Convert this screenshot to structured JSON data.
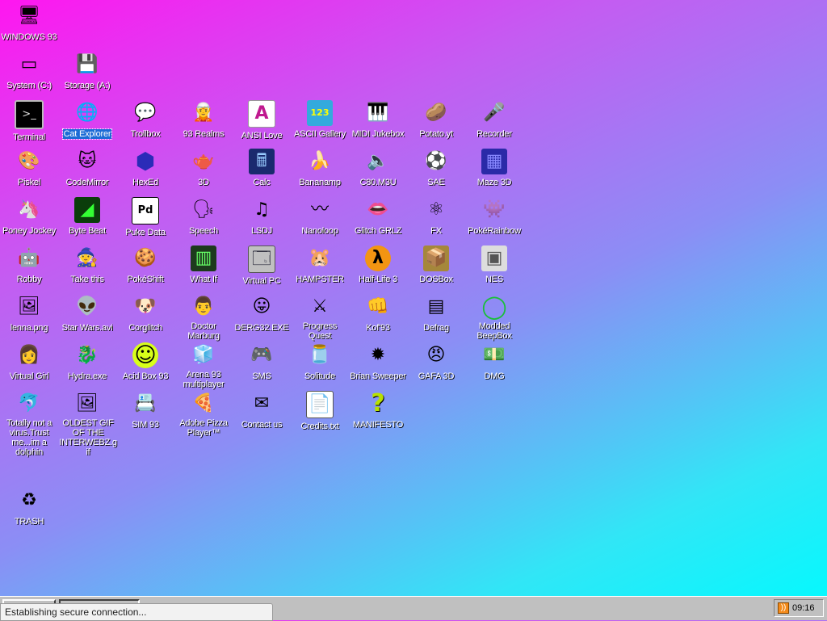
{
  "desktop_icons": [
    {
      "id": "windows93",
      "label": "WINDOWS 93",
      "glyph": "🖥",
      "icon": "computer-icon"
    },
    {
      "id": "system-c",
      "label": "System (C:)",
      "glyph": "▭",
      "icon": "hard-drive-icon"
    },
    {
      "id": "storage-a",
      "label": "Storage (A:)",
      "glyph": "💾",
      "icon": "floppy-drive-icon"
    },
    {
      "id": "terminal",
      "label": "Terminal",
      "glyph": ">_",
      "icon": "terminal-icon"
    },
    {
      "id": "cat-explorer",
      "label": "Cat Explorer",
      "glyph": "🌐",
      "icon": "cat-explorer-icon",
      "selected": true
    },
    {
      "id": "trollbox",
      "label": "Trollbox",
      "glyph": "💬",
      "icon": "chat-icon"
    },
    {
      "id": "93-realms",
      "label": "93 Realms",
      "glyph": "🧝",
      "icon": "realms-icon"
    },
    {
      "id": "ansi-love",
      "label": "ANSI Love",
      "glyph": "A",
      "icon": "ansi-icon"
    },
    {
      "id": "ascii-gallery",
      "label": "ASCII Gallery",
      "glyph": "123",
      "icon": "ascii-icon"
    },
    {
      "id": "midi-jukebox",
      "label": "MIDI Jukebox",
      "glyph": "🎹",
      "icon": "piano-icon"
    },
    {
      "id": "potato-yt",
      "label": "Potato.yt",
      "glyph": "🥔",
      "icon": "potato-icon"
    },
    {
      "id": "recorder",
      "label": "Recorder",
      "glyph": "🎤",
      "icon": "microphone-icon"
    },
    {
      "id": "piskel",
      "label": "Piskel",
      "glyph": "🎨",
      "icon": "palette-icon"
    },
    {
      "id": "codemirror",
      "label": "CodeMirror",
      "glyph": "🐱",
      "icon": "codemirror-icon"
    },
    {
      "id": "hexed",
      "label": "HexEd",
      "glyph": "⬢",
      "icon": "cube-icon"
    },
    {
      "id": "3d",
      "label": "3D",
      "glyph": "🫖",
      "icon": "teapot-icon"
    },
    {
      "id": "calc",
      "label": "Calc",
      "glyph": "🖩",
      "icon": "calculator-icon"
    },
    {
      "id": "bananamp",
      "label": "Bananamp",
      "glyph": "🍌",
      "icon": "banana-icon"
    },
    {
      "id": "c80m3u",
      "label": "C80.M3U",
      "glyph": "🔈",
      "icon": "playlist-icon"
    },
    {
      "id": "sae",
      "label": "SAE",
      "glyph": "⚽",
      "icon": "ball-icon"
    },
    {
      "id": "maze-3d",
      "label": "Maze 3D",
      "glyph": "▦",
      "icon": "maze-icon"
    },
    {
      "id": "poney-jockey",
      "label": "Poney Jockey",
      "glyph": "🦄",
      "icon": "pony-icon"
    },
    {
      "id": "byte-beat",
      "label": "Byte Beat",
      "glyph": "◢",
      "icon": "bytebeat-icon"
    },
    {
      "id": "puke-data",
      "label": "Puke Data",
      "glyph": "Pd",
      "icon": "puredata-icon"
    },
    {
      "id": "speech",
      "label": "Speech",
      "glyph": "🗣",
      "icon": "speech-icon"
    },
    {
      "id": "lsdj",
      "label": "LSDJ",
      "glyph": "♫",
      "icon": "lsdj-icon"
    },
    {
      "id": "nanoloop",
      "label": "Nanoloop",
      "glyph": "〰",
      "icon": "nanoloop-icon"
    },
    {
      "id": "glitch-grlz",
      "label": "Glitch GRLZ",
      "glyph": "👄",
      "icon": "lips-icon"
    },
    {
      "id": "fx",
      "label": "FX",
      "glyph": "⚛",
      "icon": "atom-icon"
    },
    {
      "id": "pokerainbow",
      "label": "PokéRainbow",
      "glyph": "👾",
      "icon": "pokerainbow-icon"
    },
    {
      "id": "robby",
      "label": "Robby",
      "glyph": "🤖",
      "icon": "robot-icon"
    },
    {
      "id": "take-this",
      "label": "Take this",
      "glyph": "🧙",
      "icon": "old-man-icon"
    },
    {
      "id": "pokeshift",
      "label": "PokéShift",
      "glyph": "🍪",
      "icon": "pokeshift-icon"
    },
    {
      "id": "what-if",
      "label": "What If",
      "glyph": "▥",
      "icon": "whatif-icon"
    },
    {
      "id": "virtual-pc",
      "label": "Virtual PC",
      "glyph": "🗔",
      "icon": "window-icon"
    },
    {
      "id": "hampster",
      "label": "HAMPSTER",
      "glyph": "🐹",
      "icon": "hamster-icon"
    },
    {
      "id": "half-life-3",
      "label": "Half-Life 3",
      "glyph": "λ",
      "icon": "lambda-icon"
    },
    {
      "id": "dosbox",
      "label": "DOSBox",
      "glyph": "📦",
      "icon": "box-icon"
    },
    {
      "id": "nes",
      "label": "NES",
      "glyph": "▣",
      "icon": "console-icon"
    },
    {
      "id": "lenna-png",
      "label": "lenna.png",
      "glyph": "🖼",
      "icon": "image-file-icon"
    },
    {
      "id": "star-wars",
      "label": "Star Wars.avi",
      "glyph": "👽",
      "icon": "yoda-icon"
    },
    {
      "id": "corglitch",
      "label": "Corglitch",
      "glyph": "🐶",
      "icon": "corgi-icon"
    },
    {
      "id": "doctor-marburg",
      "label": "Doctor Marburg",
      "glyph": "👨",
      "icon": "doctor-icon"
    },
    {
      "id": "derg32",
      "label": "DERG32.EXE",
      "glyph": "😛",
      "icon": "monitor-face-icon"
    },
    {
      "id": "progress-quest",
      "label": "Progress Quest",
      "glyph": "⚔",
      "icon": "swords-icon"
    },
    {
      "id": "kof93",
      "label": "Kof'93",
      "glyph": "👊",
      "icon": "fighter-icon"
    },
    {
      "id": "defrag",
      "label": "Defrag",
      "glyph": "▤",
      "icon": "defrag-icon"
    },
    {
      "id": "modded-beepbox",
      "label": "Modded BeepBox",
      "glyph": "◯",
      "icon": "ring-icon"
    },
    {
      "id": "virtual-girl",
      "label": "Virtual Girl",
      "glyph": "👩",
      "icon": "girl-icon"
    },
    {
      "id": "hydra-exe",
      "label": "Hydra.exe",
      "glyph": "🐉",
      "icon": "dragon-icon"
    },
    {
      "id": "acid-box-93",
      "label": "Acid Box 93",
      "glyph": "☺",
      "icon": "smiley-icon"
    },
    {
      "id": "arena-93",
      "label": "Arena 93 multiplayer",
      "glyph": "🧊",
      "icon": "arena-cube-icon"
    },
    {
      "id": "sms",
      "label": "SMS",
      "glyph": "🎮",
      "icon": "master-system-icon"
    },
    {
      "id": "solitude",
      "label": "Solitude",
      "glyph": "🫙",
      "icon": "jar-icon"
    },
    {
      "id": "brian-sweeper",
      "label": "Brian Sweeper",
      "glyph": "✹",
      "icon": "mine-icon"
    },
    {
      "id": "gafa-3d",
      "label": "GAFA 3D",
      "glyph": "😠",
      "icon": "doomguy-icon"
    },
    {
      "id": "dmg",
      "label": "DMG",
      "glyph": "💵",
      "icon": "money-icon"
    },
    {
      "id": "dolphin",
      "label": "Totally not a virus.Trust me...im a dolphin",
      "glyph": "🐬",
      "icon": "dolphin-icon",
      "shortcut": true
    },
    {
      "id": "oldest-gif",
      "label": "OLDEST GIF OF THE INTERWEBZ.gif",
      "glyph": "🖼",
      "icon": "gif-file-icon"
    },
    {
      "id": "sim93",
      "label": "SIM 93",
      "glyph": "📇",
      "icon": "sim-icon"
    },
    {
      "id": "adobe-pizza",
      "label": "Adobe Pizza Player™",
      "glyph": "🍕",
      "icon": "pizza-icon"
    },
    {
      "id": "contact-us",
      "label": "Contact us",
      "glyph": "✉",
      "icon": "letter-icon"
    },
    {
      "id": "credits",
      "label": "Credits.txt",
      "glyph": "📄",
      "icon": "text-file-icon"
    },
    {
      "id": "manifesto",
      "label": "MANIFESTO",
      "glyph": "?",
      "icon": "question-mark-icon"
    },
    {
      "id": "trash",
      "label": "TRASH",
      "glyph": "♻",
      "icon": "trash-icon"
    }
  ],
  "status_bar": {
    "text": "Establishing secure connection..."
  },
  "tray": {
    "clock": "09:16",
    "rss_glyph": "))"
  },
  "colors": {
    "selection": "#1c6bd6",
    "taskbar": "#c0c0c0"
  }
}
